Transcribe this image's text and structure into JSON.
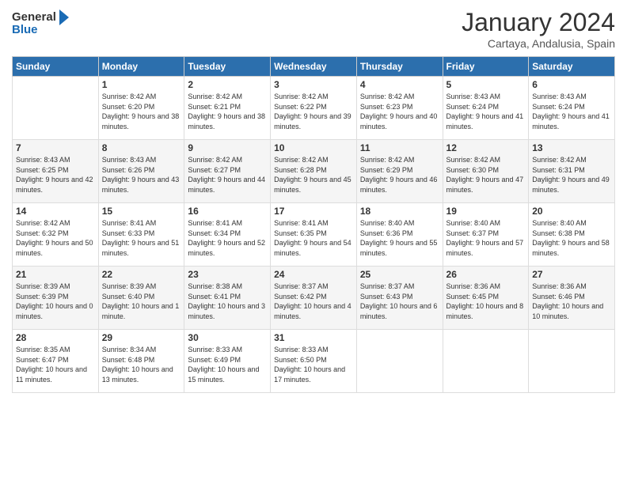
{
  "logo": {
    "line1": "General",
    "line2": "Blue"
  },
  "title": "January 2024",
  "subtitle": "Cartaya, Andalusia, Spain",
  "days_of_week": [
    "Sunday",
    "Monday",
    "Tuesday",
    "Wednesday",
    "Thursday",
    "Friday",
    "Saturday"
  ],
  "weeks": [
    [
      {
        "day": "",
        "info": ""
      },
      {
        "day": "1",
        "info": "Sunrise: 8:42 AM\nSunset: 6:20 PM\nDaylight: 9 hours\nand 38 minutes."
      },
      {
        "day": "2",
        "info": "Sunrise: 8:42 AM\nSunset: 6:21 PM\nDaylight: 9 hours\nand 38 minutes."
      },
      {
        "day": "3",
        "info": "Sunrise: 8:42 AM\nSunset: 6:22 PM\nDaylight: 9 hours\nand 39 minutes."
      },
      {
        "day": "4",
        "info": "Sunrise: 8:42 AM\nSunset: 6:23 PM\nDaylight: 9 hours\nand 40 minutes."
      },
      {
        "day": "5",
        "info": "Sunrise: 8:43 AM\nSunset: 6:24 PM\nDaylight: 9 hours\nand 41 minutes."
      },
      {
        "day": "6",
        "info": "Sunrise: 8:43 AM\nSunset: 6:24 PM\nDaylight: 9 hours\nand 41 minutes."
      }
    ],
    [
      {
        "day": "7",
        "info": "Sunrise: 8:43 AM\nSunset: 6:25 PM\nDaylight: 9 hours\nand 42 minutes."
      },
      {
        "day": "8",
        "info": "Sunrise: 8:43 AM\nSunset: 6:26 PM\nDaylight: 9 hours\nand 43 minutes."
      },
      {
        "day": "9",
        "info": "Sunrise: 8:42 AM\nSunset: 6:27 PM\nDaylight: 9 hours\nand 44 minutes."
      },
      {
        "day": "10",
        "info": "Sunrise: 8:42 AM\nSunset: 6:28 PM\nDaylight: 9 hours\nand 45 minutes."
      },
      {
        "day": "11",
        "info": "Sunrise: 8:42 AM\nSunset: 6:29 PM\nDaylight: 9 hours\nand 46 minutes."
      },
      {
        "day": "12",
        "info": "Sunrise: 8:42 AM\nSunset: 6:30 PM\nDaylight: 9 hours\nand 47 minutes."
      },
      {
        "day": "13",
        "info": "Sunrise: 8:42 AM\nSunset: 6:31 PM\nDaylight: 9 hours\nand 49 minutes."
      }
    ],
    [
      {
        "day": "14",
        "info": "Sunrise: 8:42 AM\nSunset: 6:32 PM\nDaylight: 9 hours\nand 50 minutes."
      },
      {
        "day": "15",
        "info": "Sunrise: 8:41 AM\nSunset: 6:33 PM\nDaylight: 9 hours\nand 51 minutes."
      },
      {
        "day": "16",
        "info": "Sunrise: 8:41 AM\nSunset: 6:34 PM\nDaylight: 9 hours\nand 52 minutes."
      },
      {
        "day": "17",
        "info": "Sunrise: 8:41 AM\nSunset: 6:35 PM\nDaylight: 9 hours\nand 54 minutes."
      },
      {
        "day": "18",
        "info": "Sunrise: 8:40 AM\nSunset: 6:36 PM\nDaylight: 9 hours\nand 55 minutes."
      },
      {
        "day": "19",
        "info": "Sunrise: 8:40 AM\nSunset: 6:37 PM\nDaylight: 9 hours\nand 57 minutes."
      },
      {
        "day": "20",
        "info": "Sunrise: 8:40 AM\nSunset: 6:38 PM\nDaylight: 9 hours\nand 58 minutes."
      }
    ],
    [
      {
        "day": "21",
        "info": "Sunrise: 8:39 AM\nSunset: 6:39 PM\nDaylight: 10 hours\nand 0 minutes."
      },
      {
        "day": "22",
        "info": "Sunrise: 8:39 AM\nSunset: 6:40 PM\nDaylight: 10 hours\nand 1 minute."
      },
      {
        "day": "23",
        "info": "Sunrise: 8:38 AM\nSunset: 6:41 PM\nDaylight: 10 hours\nand 3 minutes."
      },
      {
        "day": "24",
        "info": "Sunrise: 8:37 AM\nSunset: 6:42 PM\nDaylight: 10 hours\nand 4 minutes."
      },
      {
        "day": "25",
        "info": "Sunrise: 8:37 AM\nSunset: 6:43 PM\nDaylight: 10 hours\nand 6 minutes."
      },
      {
        "day": "26",
        "info": "Sunrise: 8:36 AM\nSunset: 6:45 PM\nDaylight: 10 hours\nand 8 minutes."
      },
      {
        "day": "27",
        "info": "Sunrise: 8:36 AM\nSunset: 6:46 PM\nDaylight: 10 hours\nand 10 minutes."
      }
    ],
    [
      {
        "day": "28",
        "info": "Sunrise: 8:35 AM\nSunset: 6:47 PM\nDaylight: 10 hours\nand 11 minutes."
      },
      {
        "day": "29",
        "info": "Sunrise: 8:34 AM\nSunset: 6:48 PM\nDaylight: 10 hours\nand 13 minutes."
      },
      {
        "day": "30",
        "info": "Sunrise: 8:33 AM\nSunset: 6:49 PM\nDaylight: 10 hours\nand 15 minutes."
      },
      {
        "day": "31",
        "info": "Sunrise: 8:33 AM\nSunset: 6:50 PM\nDaylight: 10 hours\nand 17 minutes."
      },
      {
        "day": "",
        "info": ""
      },
      {
        "day": "",
        "info": ""
      },
      {
        "day": "",
        "info": ""
      }
    ]
  ]
}
